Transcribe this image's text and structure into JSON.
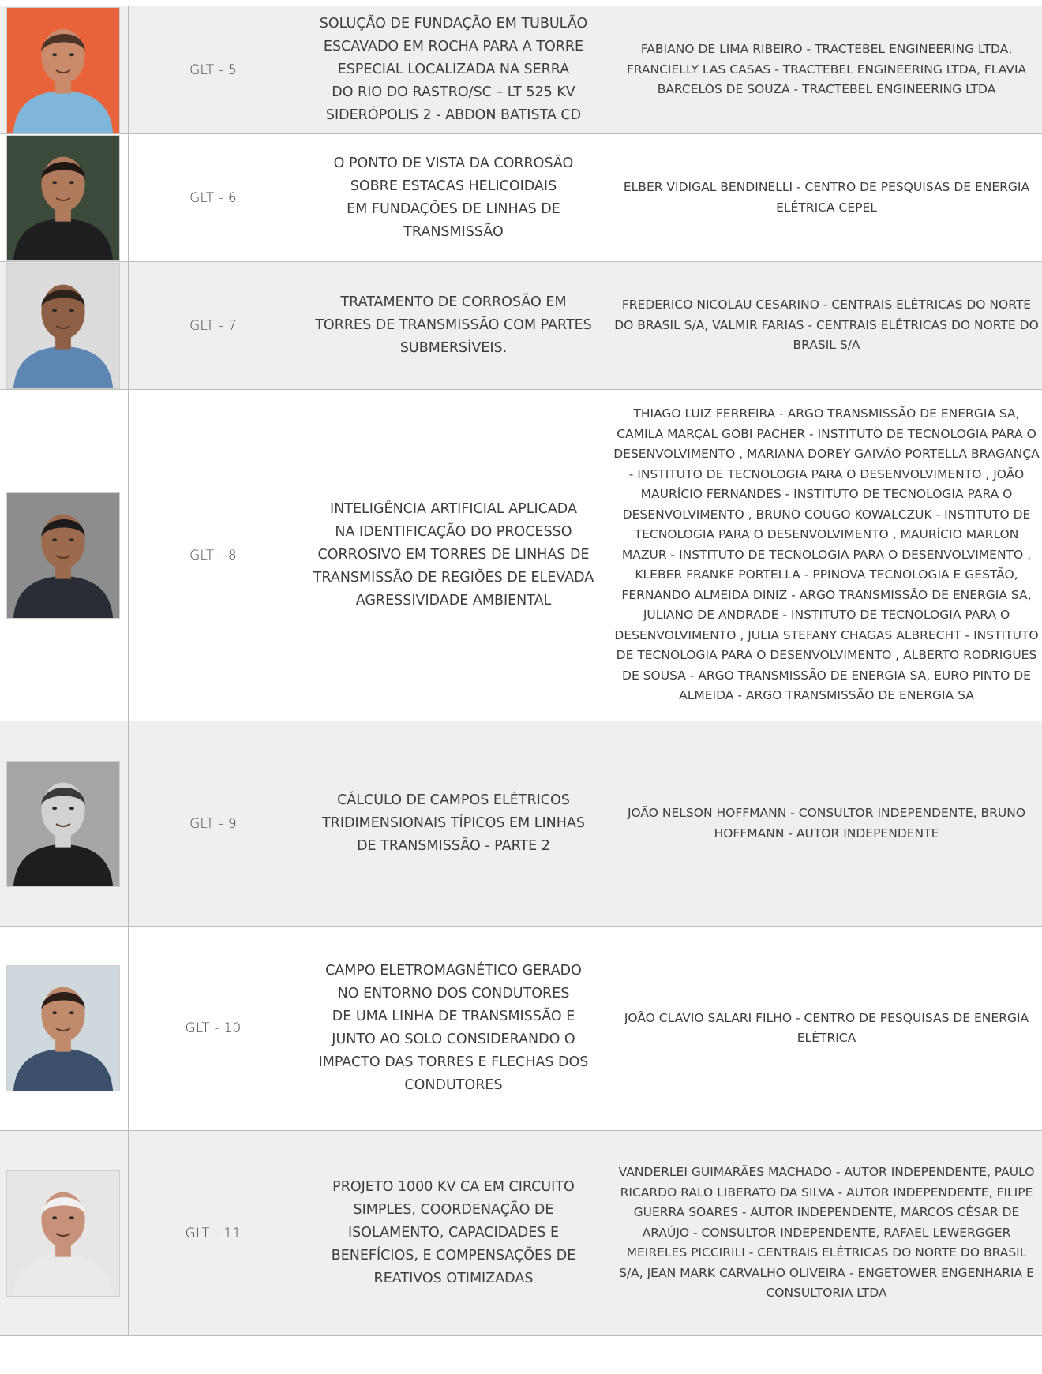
{
  "rows": [
    {
      "code": "GLT - 5",
      "title": "SOLUÇÃO DE FUNDAÇÃO EM TUBULÃO\nESCAVADO EM ROCHA PARA A TORRE\nESPECIAL LOCALIZADA NA SERRA\nDO RIO DO RASTRO/SC – LT 525 KV\nSIDERÓPOLIS 2 - ABDON BATISTA CD",
      "authors": "FABIANO DE LIMA RIBEIRO - TRACTEBEL ENGINEERING LTDA, FRANCIELLY LAS CASAS - TRACTEBEL ENGINEERING LTDA, FLAVIA BARCELOS DE SOUZA - TRACTEBEL ENGINEERING LTDA",
      "photo": {
        "icon": "speaker-photo-icon",
        "bg": "#e8623a",
        "skin": "#c98b6b",
        "hair": "#4a3327",
        "shirt": "#7fb6d9"
      }
    },
    {
      "code": "GLT - 6",
      "title": "O PONTO DE VISTA DA CORROSÃO\nSOBRE ESTACAS HELICOIDAIS\nEM FUNDAÇÕES DE LINHAS DE\nTRANSMISSÃO",
      "authors": "ELBER VIDIGAL BENDINELLI - CENTRO DE PESQUISAS DE ENERGIA ELÉTRICA CEPEL",
      "photo": {
        "icon": "speaker-photo-icon",
        "bg": "#3b4a3a",
        "skin": "#b07a5c",
        "hair": "#1e1712",
        "shirt": "#1f1f22"
      }
    },
    {
      "code": "GLT - 7",
      "title": "TRATAMENTO DE CORROSÃO EM\nTORRES DE TRANSMISSÃO COM PARTES\nSUBMERSÍVEIS.",
      "authors": "FREDERICO NICOLAU CESARINO - CENTRAIS ELÉTRICAS DO NORTE DO BRASIL S/A, VALMIR FARIAS - CENTRAIS ELÉTRICAS DO NORTE DO BRASIL S/A",
      "photo": {
        "icon": "speaker-photo-icon",
        "bg": "#dcdcdc",
        "skin": "#8d5f45",
        "hair": "#2b221c",
        "shirt": "#5e86b3"
      }
    },
    {
      "code": "GLT - 8",
      "title": "INTELIGÊNCIA ARTIFICIAL APLICADA\nNA IDENTIFICAÇÃO DO PROCESSO\nCORROSIVO EM TORRES DE LINHAS DE\nTRANSMISSÃO DE REGIÕES DE ELEVADA\nAGRESSIVIDADE AMBIENTAL",
      "authors": "THIAGO LUIZ FERREIRA - ARGO TRANSMISSÃO DE ENERGIA SA, CAMILA MARÇAL GOBI PACHER - INSTITUTO DE TECNOLOGIA PARA O DESENVOLVIMENTO , MARIANA DOREY GAIVÃO PORTELLA BRAGANÇA - INSTITUTO DE TECNOLOGIA PARA O DESENVOLVIMENTO , JOÃO MAURÍCIO FERNANDES - INSTITUTO DE TECNOLOGIA PARA O DESENVOLVIMENTO , BRUNO COUGO KOWALCZUK - INSTITUTO DE TECNOLOGIA PARA O DESENVOLVIMENTO , MAURÍCIO MARLON MAZUR - INSTITUTO DE TECNOLOGIA PARA O DESENVOLVIMENTO , KLEBER FRANKE PORTELLA - PPINOVA TECNOLOGIA E GESTÃO, FERNANDO ALMEIDA DINIZ - ARGO TRANSMISSÃO DE ENERGIA SA, JULIANO DE ANDRADE - INSTITUTO DE TECNOLOGIA PARA O DESENVOLVIMENTO , JULIA STEFANY CHAGAS ALBRECHT - INSTITUTO DE TECNOLOGIA PARA O DESENVOLVIMENTO , ALBERTO RODRIGUES DE SOUSA - ARGO TRANSMISSÃO DE ENERGIA SA, EURO PINTO DE ALMEIDA - ARGO TRANSMISSÃO DE ENERGIA SA",
      "photo": {
        "icon": "speaker-photo-icon",
        "bg": "#8d8d8d",
        "skin": "#9c6a4c",
        "hair": "#1c1a1a",
        "shirt": "#2a2d36"
      }
    },
    {
      "code": "GLT - 9",
      "title": "CÁLCULO DE CAMPOS ELÉTRICOS\nTRIDIMENSIONAIS TÍPICOS EM LINHAS\nDE TRANSMISSÃO - PARTE 2",
      "authors": "JOÃO NELSON HOFFMANN - CONSULTOR INDEPENDENTE, BRUNO HOFFMANN - AUTOR INDEPENDENTE",
      "photo": {
        "icon": "speaker-photo-icon",
        "bg": "#a6a6a6",
        "skin": "#d2d2d2",
        "hair": "#3a3a3a",
        "shirt": "#1e1e1e"
      }
    },
    {
      "code": "GLT - 10",
      "title": "CAMPO ELETROMAGNÉTICO GERADO\nNO ENTORNO DOS CONDUTORES\nDE UMA LINHA DE TRANSMISSÃO E\nJUNTO AO SOLO CONSIDERANDO O\nIMPACTO DAS TORRES E FLECHAS DOS\nCONDUTORES",
      "authors": "JOÃO CLAVIO SALARI FILHO - CENTRO DE PESQUISAS DE ENERGIA ELÉTRICA",
      "photo": {
        "icon": "speaker-photo-icon",
        "bg": "#cfd8dc",
        "skin": "#c08a6c",
        "hair": "#2a1f18",
        "shirt": "#3c4f6b"
      }
    },
    {
      "code": "GLT - 11",
      "title": "PROJETO 1000 KV CA EM CIRCUITO\nSIMPLES, COORDENAÇÃO DE\nISOLAMENTO, CAPACIDADES E\nBENEFÍCIOS, E COMPENSAÇÕES DE\nREATIVOS OTIMIZADAS",
      "authors": "VANDERLEI GUIMARÃES MACHADO - AUTOR INDEPENDENTE, PAULO RICARDO RALO LIBERATO DA SILVA - AUTOR INDEPENDENTE, FILIPE GUERRA SOARES - AUTOR INDEPENDENTE, MARCOS CÉSAR DE ARAÚJO - CONSULTOR INDEPENDENTE, RAFAEL LEWERGGER MEIRELES PICCIRILI - CENTRAIS ELÉTRICAS DO NORTE DO BRASIL S/A, JEAN MARK CARVALHO OLIVEIRA - ENGETOWER ENGENHARIA E CONSULTORIA LTDA",
      "photo": {
        "icon": "speaker-photo-icon",
        "bg": "#e6e6e6",
        "skin": "#c8927a",
        "hair": "#f1f1f1",
        "shirt": "#eaeaea"
      }
    }
  ]
}
